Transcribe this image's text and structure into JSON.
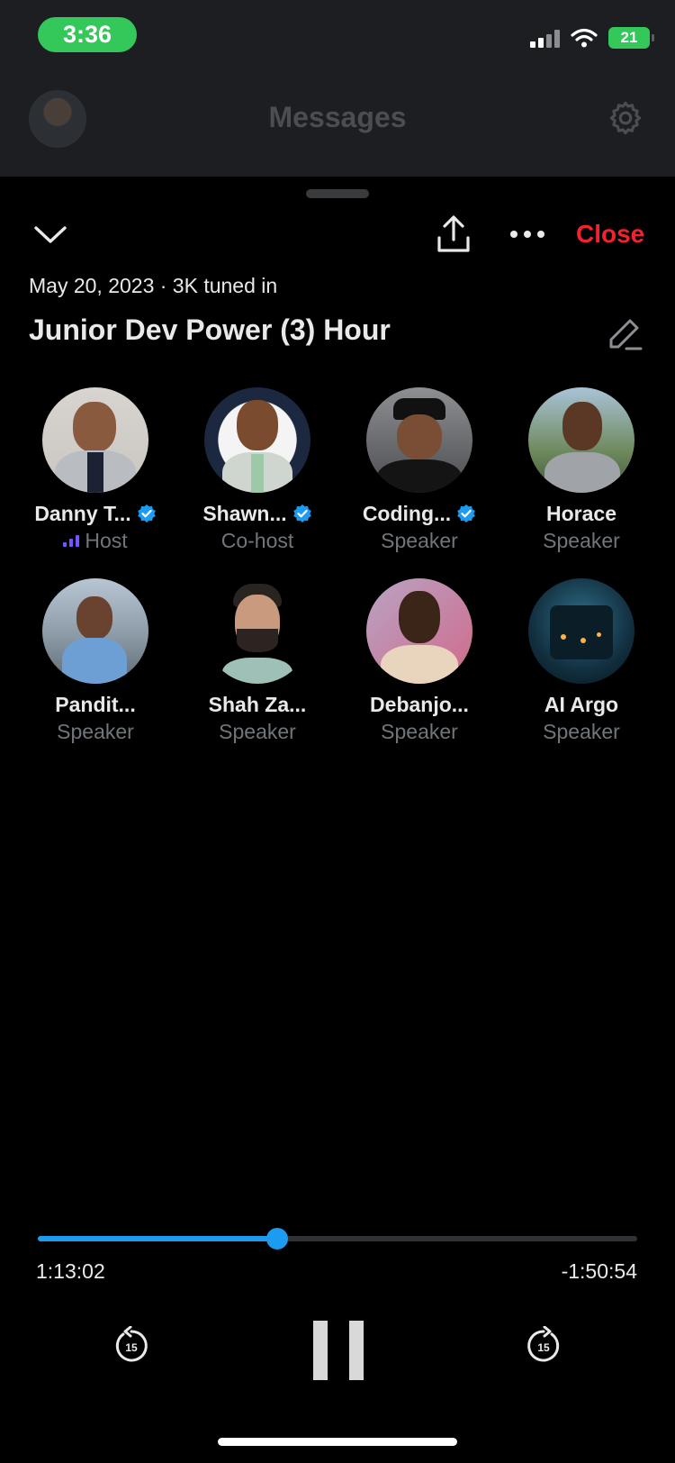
{
  "status": {
    "time": "3:36",
    "battery": "21"
  },
  "header": {
    "title": "Messages"
  },
  "space": {
    "close_label": "Close",
    "meta": "May 20, 2023 · 3K tuned in",
    "title": "Junior Dev Power (3) Hour"
  },
  "participants": [
    {
      "name": "Danny T...",
      "role": "Host",
      "verified": true,
      "speaking": true
    },
    {
      "name": "Shawn...",
      "role": "Co-host",
      "verified": true,
      "speaking": false
    },
    {
      "name": "Coding...",
      "role": "Speaker",
      "verified": true,
      "speaking": false
    },
    {
      "name": "Horace",
      "role": "Speaker",
      "verified": false,
      "speaking": false
    },
    {
      "name": "Pandit...",
      "role": "Speaker",
      "verified": false,
      "speaking": false
    },
    {
      "name": "Shah Za...",
      "role": "Speaker",
      "verified": false,
      "speaking": false
    },
    {
      "name": "Debanjo...",
      "role": "Speaker",
      "verified": false,
      "speaking": false
    },
    {
      "name": "AI Argo",
      "role": "Speaker",
      "verified": false,
      "speaking": false
    }
  ],
  "player": {
    "elapsed": "1:13:02",
    "remaining": "-1:50:54",
    "progress": 0.4,
    "skip_back_label": "15",
    "skip_forward_label": "15"
  },
  "colors": {
    "accent": "#1d9bf0",
    "close": "#f4212e",
    "status_time_bg": "#34c759",
    "speaking_indicator": "#7856ff"
  }
}
